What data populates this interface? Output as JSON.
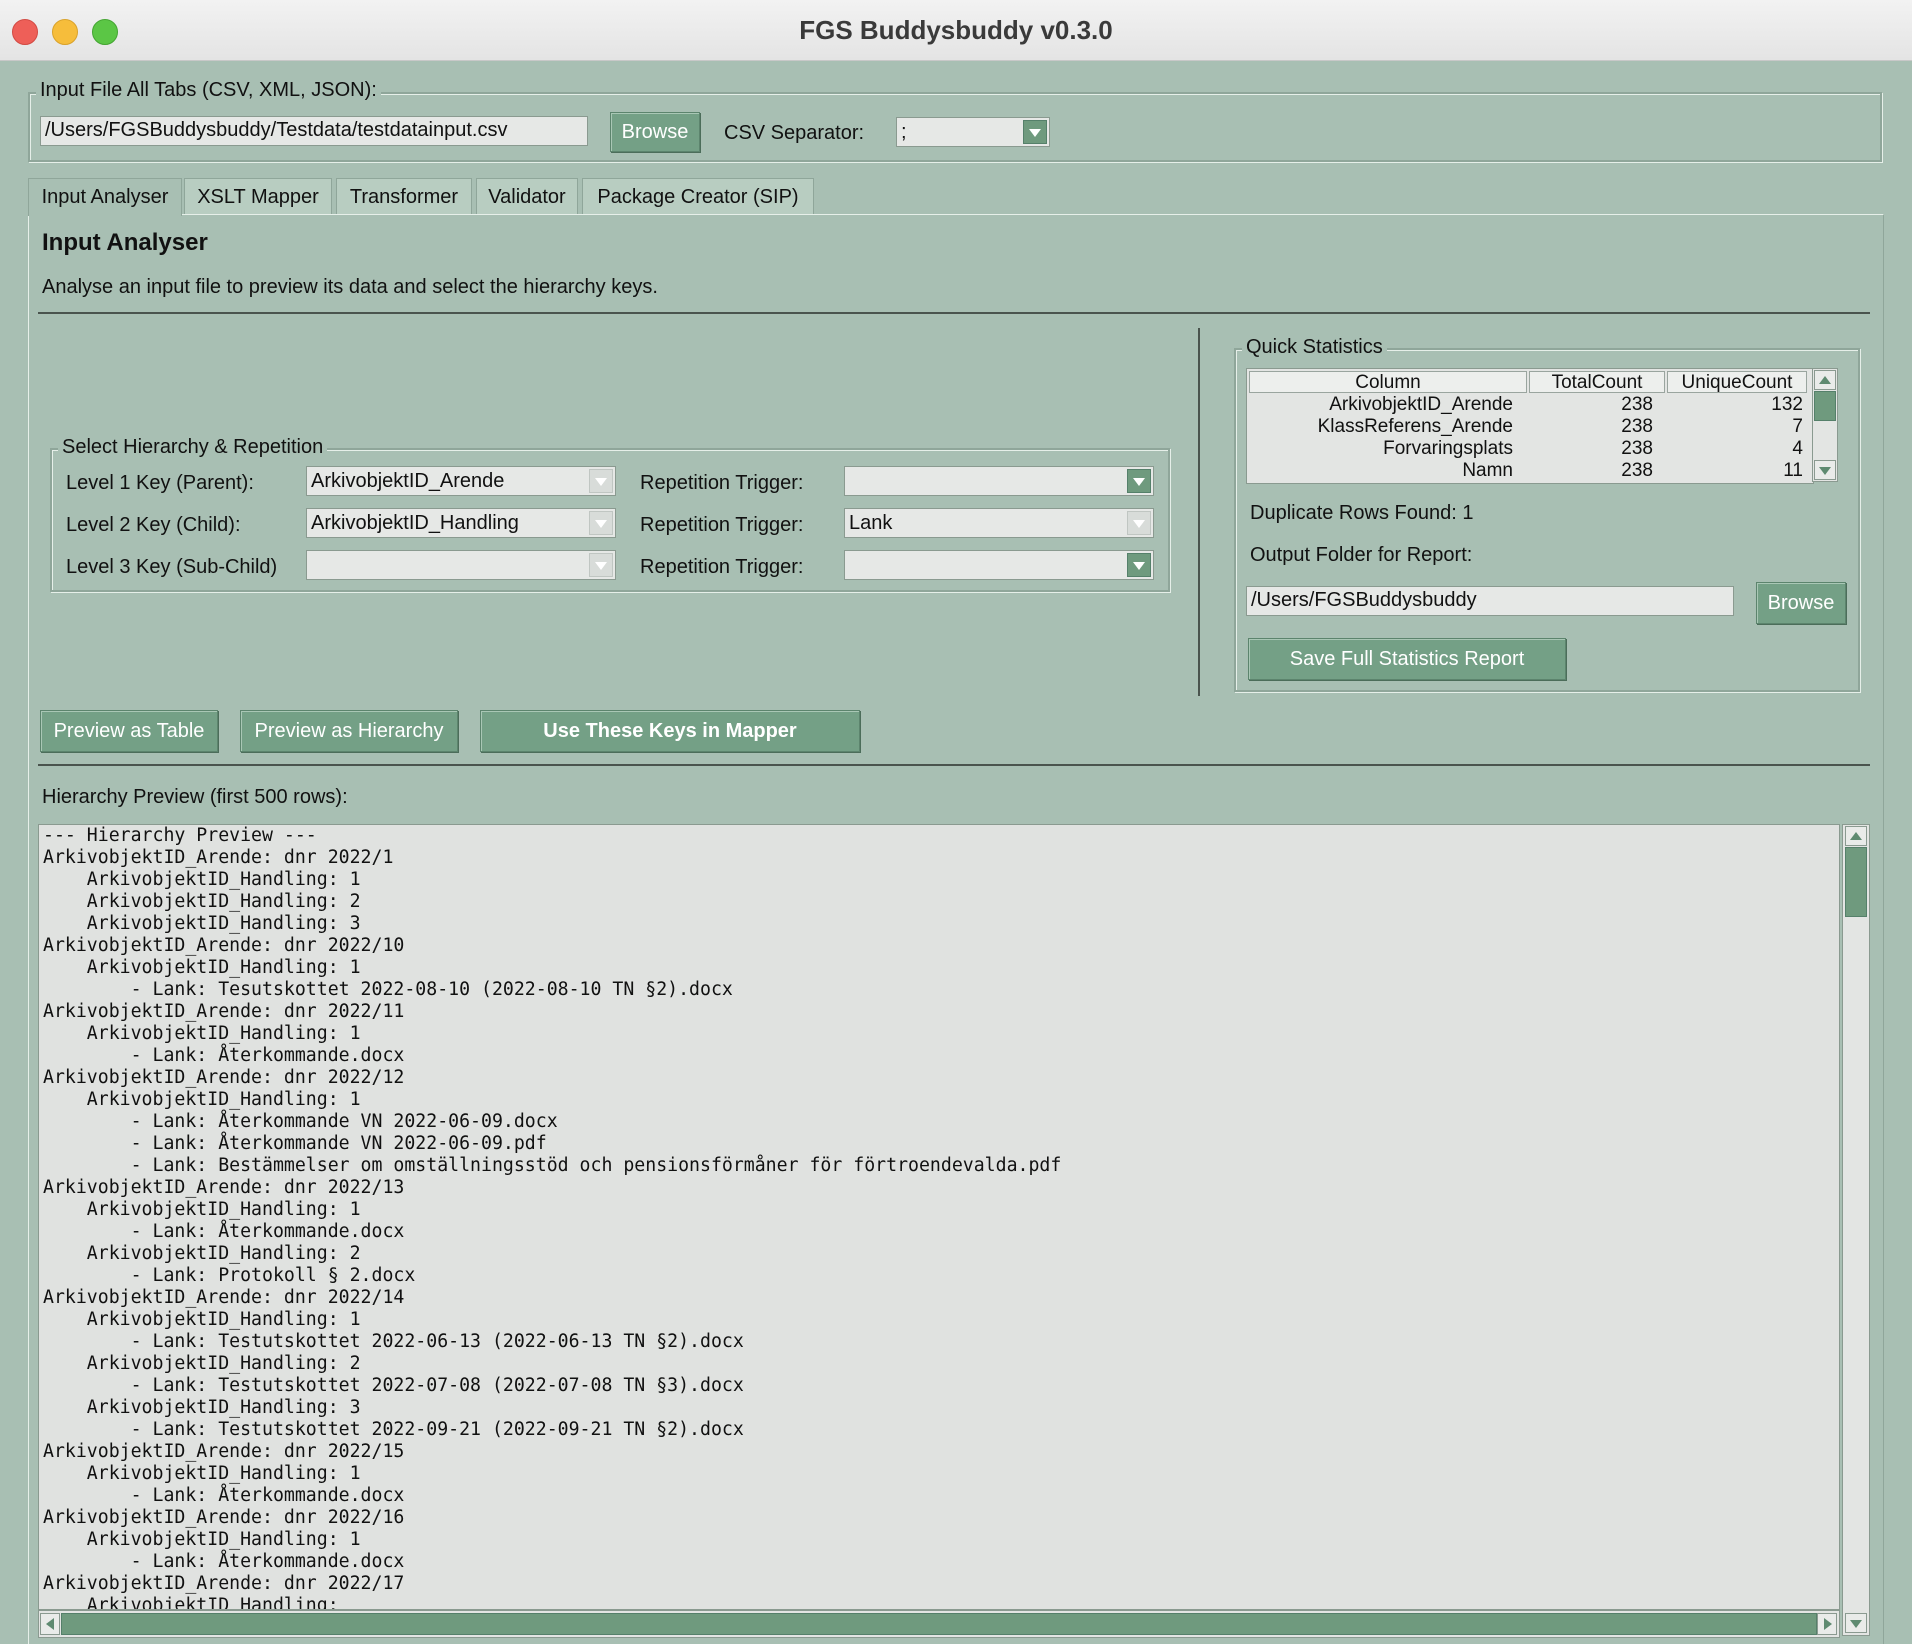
{
  "window": {
    "title": "FGS Buddysbuddy v0.3.0"
  },
  "input_file": {
    "group_label": "Input File All Tabs (CSV, XML, JSON):",
    "path": "/Users/FGSBuddysbuddy/Testdata/testdatainput.csv",
    "browse_label": "Browse",
    "separator_label": "CSV Separator:",
    "separator_value": ";"
  },
  "tabs": [
    {
      "label": "Input Analyser"
    },
    {
      "label": "XSLT Mapper"
    },
    {
      "label": "Transformer"
    },
    {
      "label": "Validator"
    },
    {
      "label": "Package Creator (SIP)"
    }
  ],
  "page": {
    "title": "Input Analyser",
    "description": "Analyse an input file to preview its data and select the hierarchy keys."
  },
  "hierarchy": {
    "group_label": "Select Hierarchy & Repetition",
    "levels": [
      {
        "label": "Level 1 Key (Parent):",
        "value": "ArkivobjektID_Arende",
        "trigger_label": "Repetition Trigger:",
        "trigger_value": ""
      },
      {
        "label": "Level 2 Key (Child):",
        "value": "ArkivobjektID_Handling",
        "trigger_label": "Repetition Trigger:",
        "trigger_value": "Lank"
      },
      {
        "label": "Level 3 Key (Sub-Child)",
        "value": "",
        "trigger_label": "Repetition Trigger:",
        "trigger_value": ""
      }
    ]
  },
  "stats": {
    "group_label": "Quick Statistics",
    "columns": [
      "Column",
      "TotalCount",
      "UniqueCount"
    ],
    "rows": [
      {
        "column": "ArkivobjektID_Arende",
        "total": "238",
        "unique": "132"
      },
      {
        "column": "KlassReferens_Arende",
        "total": "238",
        "unique": "7"
      },
      {
        "column": "Forvaringsplats",
        "total": "238",
        "unique": "4"
      },
      {
        "column": "Namn",
        "total": "238",
        "unique": "11"
      }
    ],
    "duplicates": "Duplicate Rows Found: 1",
    "output_label": "Output Folder for Report:",
    "output_path": "/Users/FGSBuddysbuddy",
    "browse_label": "Browse",
    "save_label": "Save Full Statistics Report"
  },
  "actions": {
    "preview_table": "Preview as Table",
    "preview_hierarchy": "Preview as Hierarchy",
    "use_keys": "Use These Keys in Mapper"
  },
  "preview": {
    "label": "Hierarchy Preview (first 500 rows):",
    "text": "--- Hierarchy Preview ---\nArkivobjektID_Arende: dnr 2022/1\n    ArkivobjektID_Handling: 1\n    ArkivobjektID_Handling: 2\n    ArkivobjektID_Handling: 3\nArkivobjektID_Arende: dnr 2022/10\n    ArkivobjektID_Handling: 1\n        - Lank: Tesutskottet 2022-08-10 (2022-08-10 TN §2).docx\nArkivobjektID_Arende: dnr 2022/11\n    ArkivobjektID_Handling: 1\n        - Lank: Återkommande.docx\nArkivobjektID_Arende: dnr 2022/12\n    ArkivobjektID_Handling: 1\n        - Lank: Återkommande VN 2022-06-09.docx\n        - Lank: Återkommande VN 2022-06-09.pdf\n        - Lank: Bestämmelser om omställningsstöd och pensionsförmåner för förtroendevalda.pdf\nArkivobjektID_Arende: dnr 2022/13\n    ArkivobjektID_Handling: 1\n        - Lank: Återkommande.docx\n    ArkivobjektID_Handling: 2\n        - Lank: Protokoll § 2.docx\nArkivobjektID_Arende: dnr 2022/14\n    ArkivobjektID_Handling: 1\n        - Lank: Testutskottet 2022-06-13 (2022-06-13 TN §2).docx\n    ArkivobjektID_Handling: 2\n        - Lank: Testutskottet 2022-07-08 (2022-07-08 TN §3).docx\n    ArkivobjektID_Handling: 3\n        - Lank: Testutskottet 2022-09-21 (2022-09-21 TN §2).docx\nArkivobjektID_Arende: dnr 2022/15\n    ArkivobjektID_Handling: 1\n        - Lank: Återkommande.docx\nArkivobjektID_Arende: dnr 2022/16\n    ArkivobjektID_Handling: 1\n        - Lank: Återkommande.docx\nArkivobjektID_Arende: dnr 2022/17\n    ArkivobjektID_Handling:"
  }
}
